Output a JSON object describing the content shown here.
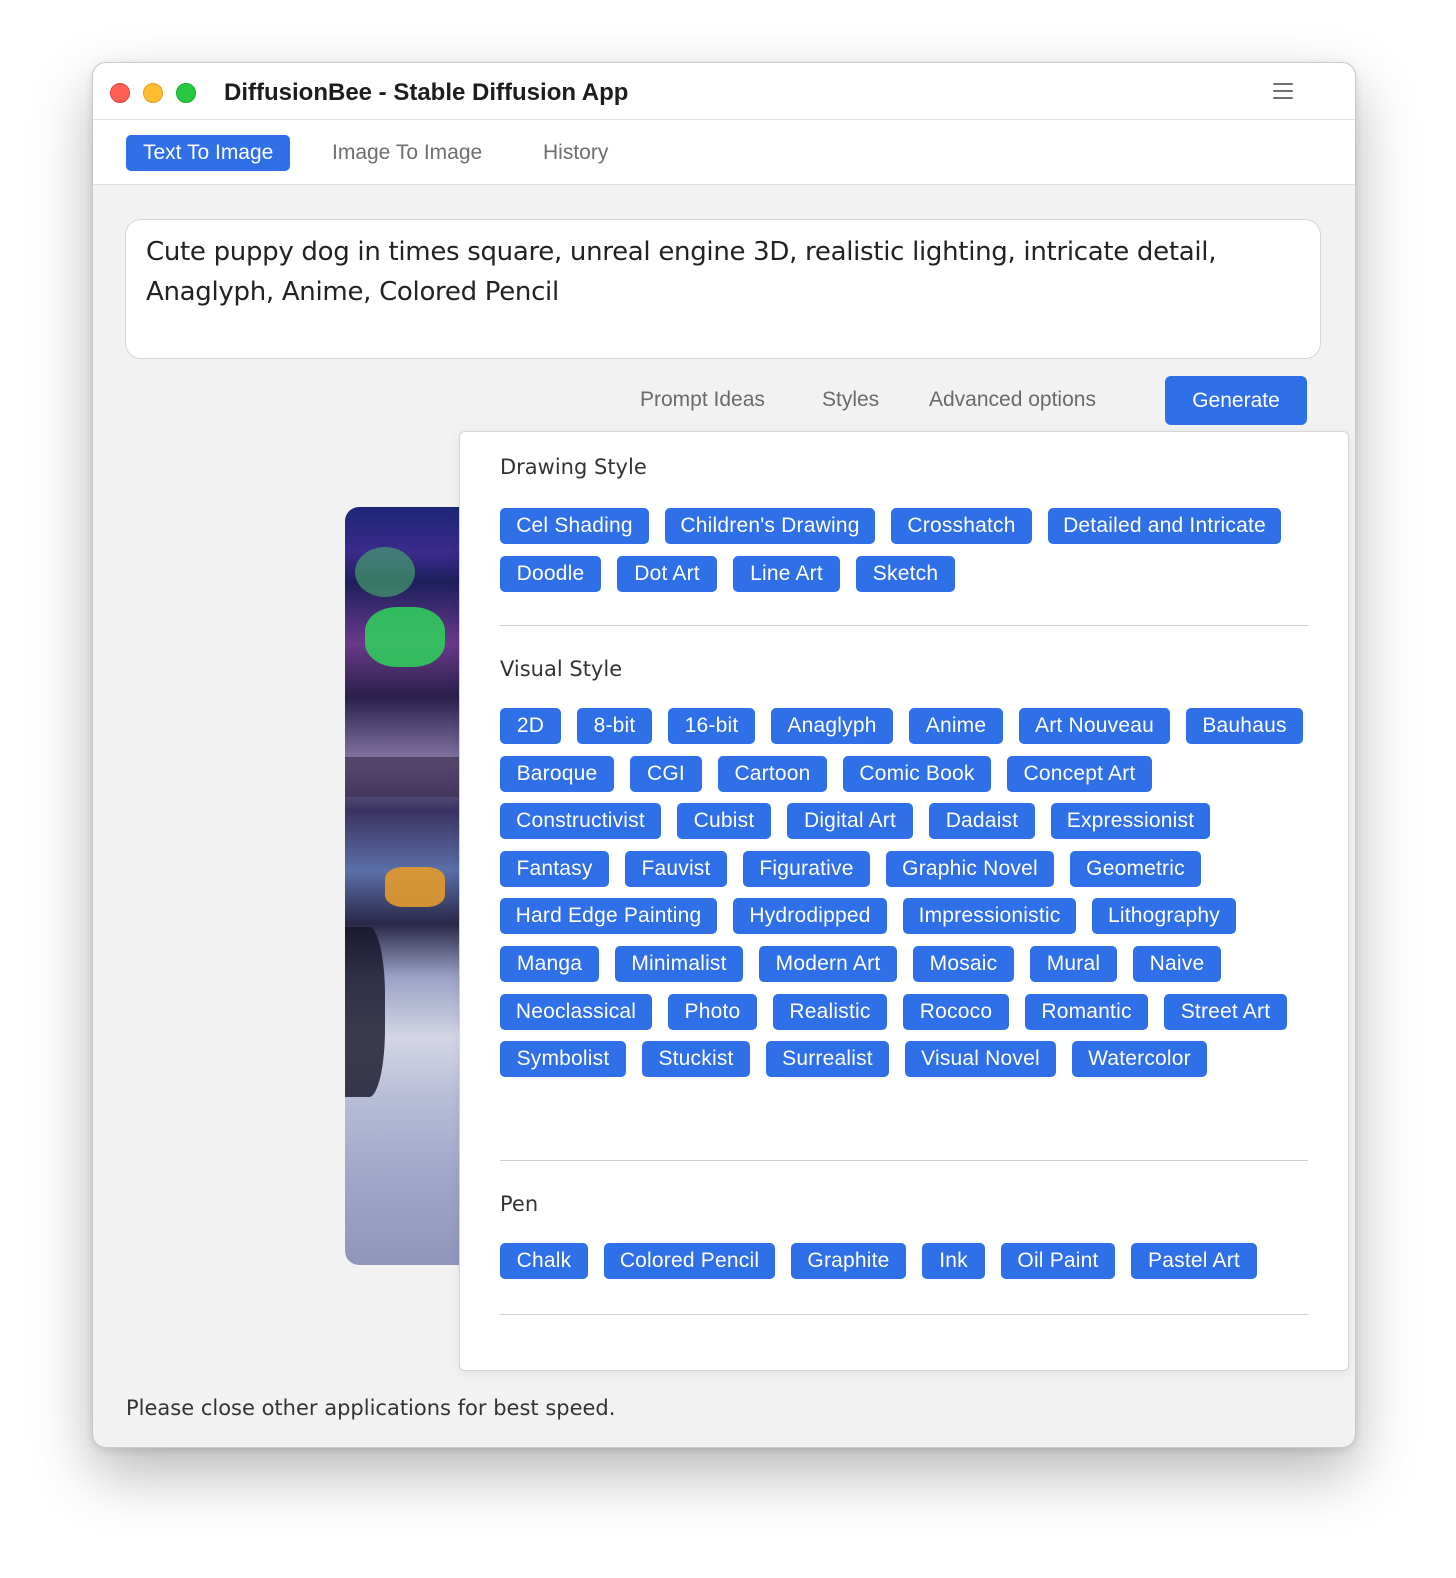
{
  "window": {
    "title": "DiffusionBee - Stable Diffusion App"
  },
  "tabs": [
    {
      "label": "Text To Image",
      "active": true
    },
    {
      "label": "Image To Image",
      "active": false
    },
    {
      "label": "History",
      "active": false
    }
  ],
  "prompt": {
    "value": "Cute puppy dog in times square, unreal engine 3D, realistic lighting, intricate detail, Anaglyph, Anime, Colored Pencil"
  },
  "options": {
    "prompt_ideas": "Prompt Ideas",
    "styles": "Styles",
    "advanced": "Advanced options",
    "generate": "Generate"
  },
  "styles_panel": {
    "sections": [
      {
        "title": "Drawing Style",
        "chips": [
          "Cel Shading",
          "Children's Drawing",
          "Crosshatch",
          "Detailed and Intricate",
          "Doodle",
          "Dot Art",
          "Line Art",
          "Sketch"
        ]
      },
      {
        "title": "Visual Style",
        "chips": [
          "2D",
          "8-bit",
          "16-bit",
          "Anaglyph",
          "Anime",
          "Art Nouveau",
          "Bauhaus",
          "Baroque",
          "CGI",
          "Cartoon",
          "Comic Book",
          "Concept Art",
          "Constructivist",
          "Cubist",
          "Digital Art",
          "Dadaist",
          "Expressionist",
          "Fantasy",
          "Fauvist",
          "Figurative",
          "Graphic Novel",
          "Geometric",
          "Hard Edge Painting",
          "Hydrodipped",
          "Impressionistic",
          "Lithography",
          "Manga",
          "Minimalist",
          "Modern Art",
          "Mosaic",
          "Mural",
          "Naive",
          "Neoclassical",
          "Photo",
          "Realistic",
          "Rococo",
          "Romantic",
          "Street Art",
          "Symbolist",
          "Stuckist",
          "Surrealist",
          "Visual Novel",
          "Watercolor"
        ]
      },
      {
        "title": "Pen",
        "chips": [
          "Chalk",
          "Colored Pencil",
          "Graphite",
          "Ink",
          "Oil Paint",
          "Pastel Art"
        ]
      }
    ]
  },
  "footer": {
    "message": "Please close other applications for best speed."
  },
  "colors": {
    "accent": "#2f6fe8",
    "window_bg": "#f2f2f2"
  },
  "icons": {
    "menu": "hamburger-menu-icon"
  }
}
